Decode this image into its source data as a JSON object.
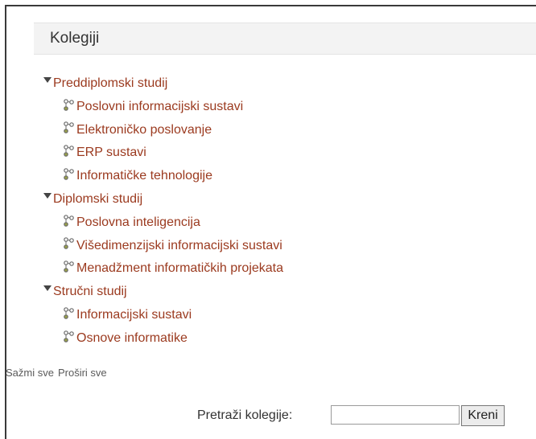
{
  "block": {
    "title": "Kolegiji"
  },
  "categories": [
    {
      "name": "Preddiplomski studij",
      "courses": [
        "Poslovni informacijski sustavi",
        "Elektroničko poslovanje",
        "ERP sustavi",
        "Informatičke tehnologije"
      ]
    },
    {
      "name": "Diplomski studij",
      "courses": [
        "Poslovna inteligencija",
        "Višedimenzijski informacijski sustavi",
        "Menadžment informatičkih projekata"
      ]
    },
    {
      "name": "Stručni studij",
      "courses": [
        "Informacijski sustavi",
        "Osnove informatike"
      ]
    }
  ],
  "controls": {
    "collapse_all": "Sažmi sve",
    "expand_all": "Proširi sve"
  },
  "search": {
    "label": "Pretraži kolegije:",
    "value": "",
    "button": "Kreni"
  },
  "colors": {
    "link": "#9b3a1f",
    "header_bg": "#f3f3f3"
  }
}
